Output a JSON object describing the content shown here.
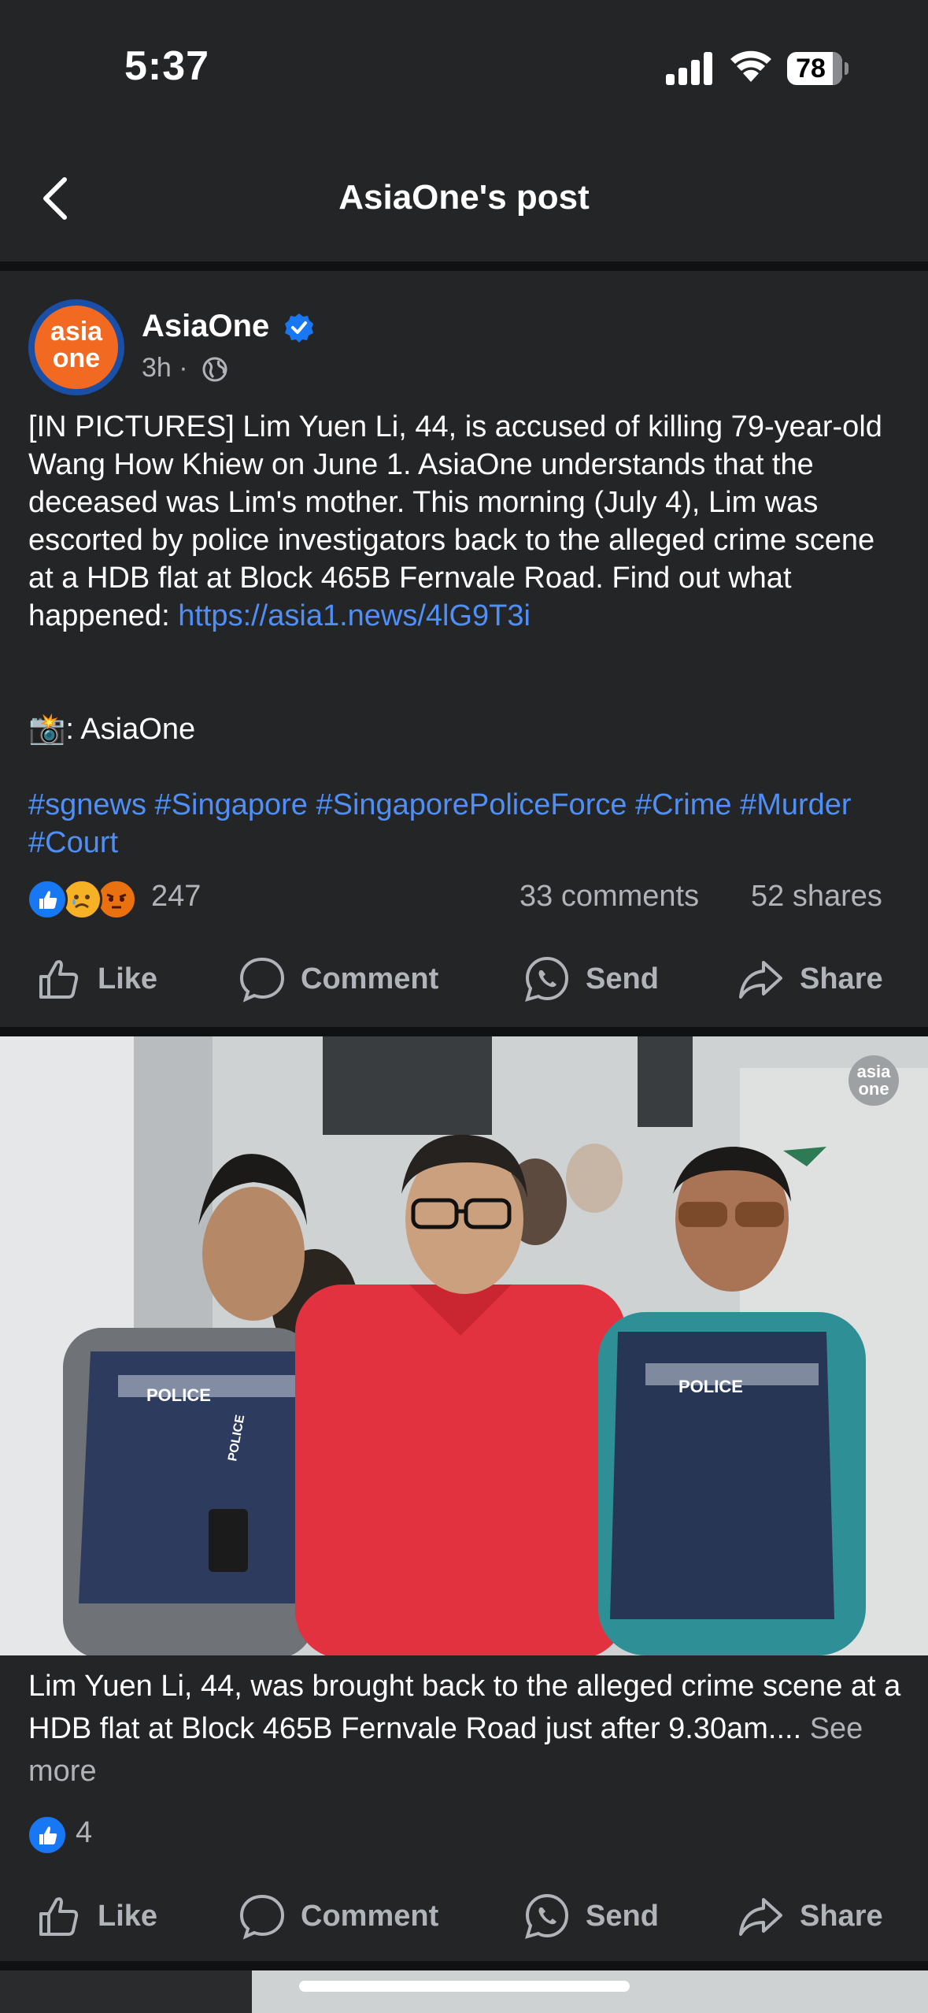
{
  "status_bar": {
    "time": "5:37",
    "battery": "78"
  },
  "header": {
    "title": "AsiaOne's post"
  },
  "post": {
    "page_name": "AsiaOne",
    "avatar_text_top": "asia",
    "avatar_text_bottom": "one",
    "time": "3h ·",
    "text_main": "[IN PICTURES] Lim Yuen Li, 44, is accused of killing 79-year-old Wang How Khiew on June 1. AsiaOne understands that the deceased was Lim's mother. This morning (July 4), Lim was escorted by police investigators back to the alleged crime scene at a HDB flat at Block 465B Fernvale Road. Find out what happened: ",
    "link": "https://asia1.news/4lG9T3i",
    "credit": "📸: AsiaOne",
    "hashtags": "#sgnews #Singapore #SingaporePoliceForce #Crime #Murder #Court",
    "reaction_count": "247",
    "comments": "33 comments",
    "shares": "52 shares"
  },
  "actions": {
    "like": "Like",
    "comment": "Comment",
    "send": "Send",
    "share": "Share"
  },
  "photo": {
    "watermark": "asia one",
    "police_label_left": "POLICE",
    "police_label_right": "POLICE",
    "lanyard_label": "POLICE",
    "caption": "Lim Yuen Li, 44, was brought back to the alleged crime scene at a HDB flat at Block 465B Fernvale Road just after 9.30am.... ",
    "see_more": "See more",
    "reaction_count": "4"
  },
  "colors": {
    "background": "#242527",
    "link": "#4f8ff7",
    "like_blue": "#1877f2",
    "avatar_orange": "#f26a21"
  }
}
